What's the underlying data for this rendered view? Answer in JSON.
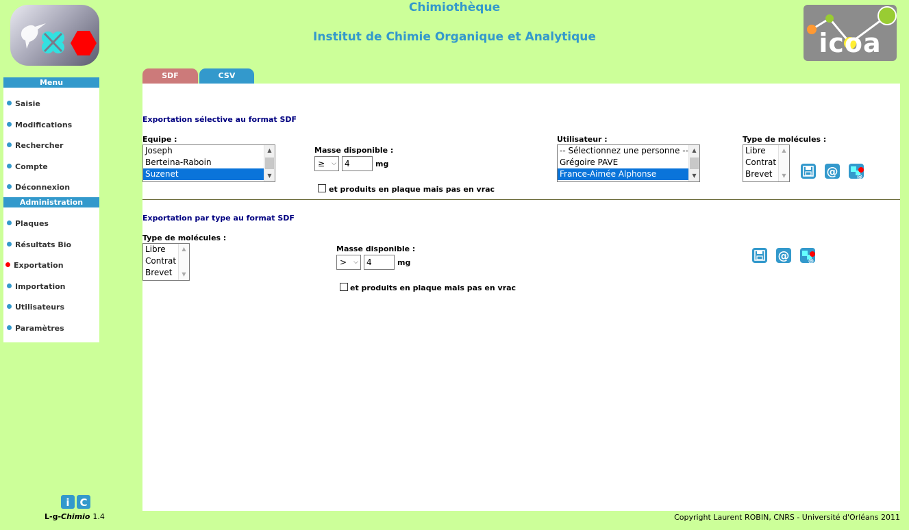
{
  "header": {
    "app_title": "Chimiothèque",
    "institute_title": "Institut de Chimie Organique et Analytique",
    "right_logo_text": "icoa"
  },
  "sidebar": {
    "menu_header": "Menu",
    "menu_items": [
      {
        "label": "Saisie"
      },
      {
        "label": "Modifications"
      },
      {
        "label": "Rechercher"
      },
      {
        "label": "Compte"
      },
      {
        "label": "Déconnexion"
      }
    ],
    "admin_header": "Administration",
    "admin_items": [
      {
        "label": "Plaques"
      },
      {
        "label": "Résultats Bio"
      },
      {
        "label": "Exportation",
        "active": true
      },
      {
        "label": "Importation"
      },
      {
        "label": "Utilisateurs"
      },
      {
        "label": "Paramètres"
      }
    ]
  },
  "tabs": [
    {
      "label": "SDF",
      "color": "#cc7a7a"
    },
    {
      "label": "CSV",
      "color": "#3399cc"
    }
  ],
  "selective_export": {
    "title": "Exportation sélective au format SDF",
    "team_label": "Equipe :",
    "teams": [
      "Joseph",
      "Berteina-Raboin",
      "Suzenet"
    ],
    "team_selected": "Suzenet",
    "mass_label": "Masse disponible :",
    "mass_operator": "≥",
    "mass_value": "4",
    "mass_unit": "mg",
    "plate_checkbox_label": "et produits en plaque mais pas en vrac",
    "user_label": "Utilisateur :",
    "users": [
      "-- Sélectionnez une personne --",
      "Grégoire PAVE",
      "France-Aimée Alphonse"
    ],
    "user_selected": "France-Aimée Alphonse",
    "molecule_type_label": "Type de molécules :",
    "molecule_types": [
      "Libre",
      "Contrat",
      "Brevet"
    ]
  },
  "type_export": {
    "title": "Exportation par type au format SDF",
    "molecule_type_label": "Type de molécules :",
    "molecule_types": [
      "Libre",
      "Contrat",
      "Brevet"
    ],
    "mass_label": "Masse disponible :",
    "mass_operator": ">",
    "mass_value": "4",
    "mass_unit": "mg",
    "plate_checkbox_label": "et produits en plaque mais pas en vrac"
  },
  "action_icons": [
    "save-icon",
    "email-icon",
    "chemistry-email-icon"
  ],
  "footer": {
    "version_prefix": "L-g-",
    "version_name": "Chimio",
    "version_number": "1.4",
    "copyright": "Copyright Laurent ROBIN, CNRS - Université d'Orléans 2011"
  },
  "colors": {
    "page_background": "#ccff99",
    "accent": "#3399cc",
    "section_title": "#000080",
    "tab_sdf": "#cc7a7a",
    "tab_csv": "#3399cc",
    "active_marker": "#ff0000",
    "selection": "#0a74da"
  }
}
